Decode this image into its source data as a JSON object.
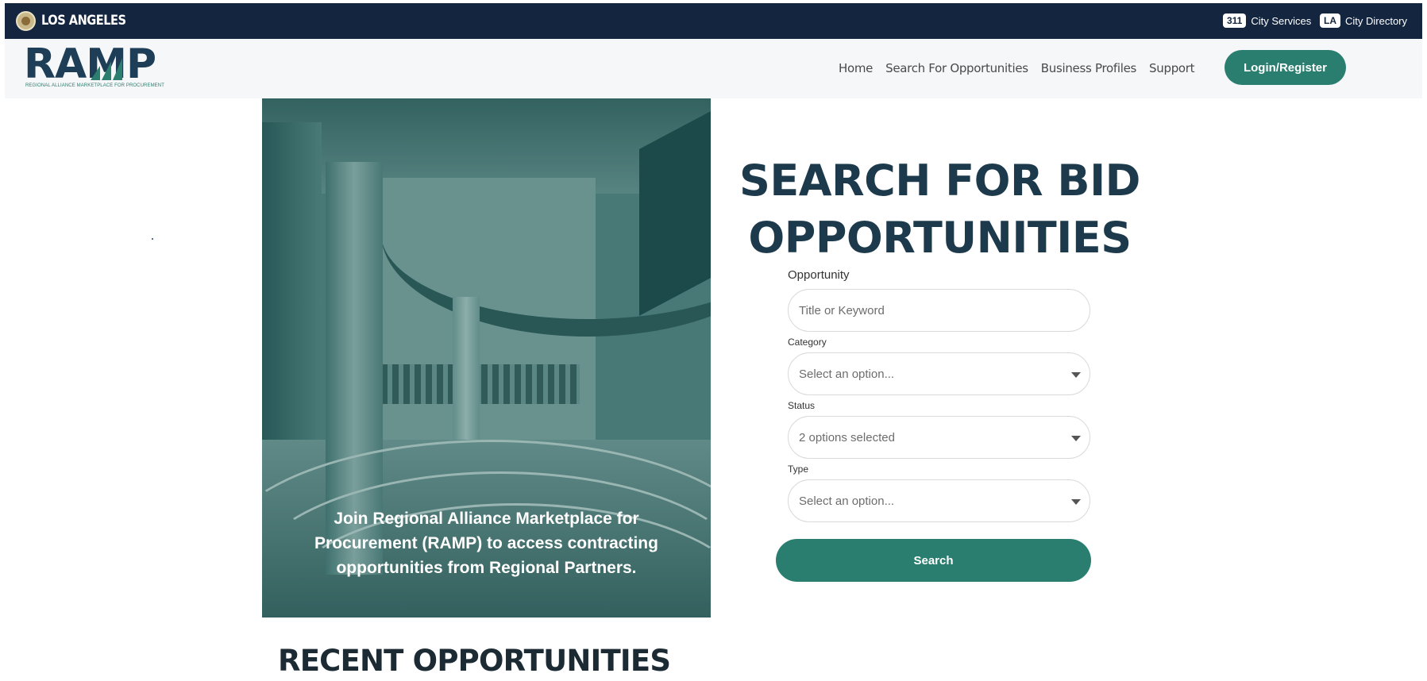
{
  "city_bar": {
    "city_name": "LOS ANGELES",
    "links": [
      {
        "badge": "311",
        "label": "City Services"
      },
      {
        "badge": "LA",
        "label": "City Directory"
      }
    ]
  },
  "header": {
    "logo_text": "RAMP",
    "logo_subtitle": "REGIONAL ALLIANCE MARKETPLACE FOR PROCUREMENT",
    "nav": [
      "Home",
      "Search For Opportunities",
      "Business Profiles",
      "Support"
    ],
    "login_label": "Login/Register"
  },
  "hero": {
    "text": "Join Regional Alliance Marketplace for Procurement (RAMP) to access contracting opportunities from Regional Partners."
  },
  "search": {
    "title_line1": "SEARCH FOR BID",
    "title_line2": "OPPORTUNITIES",
    "opportunity_label": "Opportunity",
    "opportunity_placeholder": "Title or Keyword",
    "category_label": "Category",
    "category_value": "Select an option...",
    "status_label": "Status",
    "status_value": "2 options selected",
    "type_label": "Type",
    "type_value": "Select an option...",
    "search_button": "Search"
  },
  "recent": {
    "title": "RECENT OPPORTUNITIES"
  },
  "colors": {
    "city_bar": "#13253f",
    "brand_green": "#297e6f",
    "brand_navy": "#1d3e56"
  }
}
